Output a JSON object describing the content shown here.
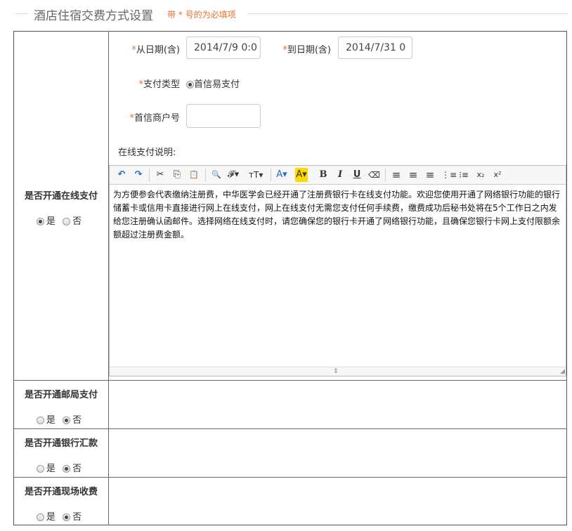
{
  "section": {
    "title": "酒店住宿交费方式设置",
    "hint": "带 * 号的为必填项"
  },
  "online": {
    "label": "是否开通在线支付",
    "yes": "是",
    "no": "否",
    "selected": "yes",
    "from_label": "从日期(含)",
    "from_value": "2014/7/9 0:0",
    "to_label": "到日期(含)",
    "to_value": "2014/7/31 0",
    "paytype_label": "支付类型",
    "paytype_option": "首信易支付",
    "merchant_label": "首信商户号",
    "merchant_value": "",
    "desc_label": "在线支付说明:",
    "desc_text": "为方便参会代表缴纳注册费，中华医学会已经开通了注册费银行卡在线支付功能。欢迎您使用开通了网络银行功能的银行储蓄卡或信用卡直接进行网上在线支付，网上在线支付无需您支付任何手续费，缴费成功后秘书处将在5个工作日之内发给您注册确认函邮件。选择网络在线支付时，请您确保您的银行卡开通了网络银行功能，且确保您银行卡网上支付限额余额超过注册费金额。"
  },
  "toolbar": {
    "undo": "↶",
    "redo": "↷",
    "cut": "✂",
    "copy": "⎘",
    "paste": "📋",
    "find": "🔍",
    "font": "𝓕▾",
    "size": "тT▾",
    "color": "A▾",
    "bg": "A▾",
    "bold": "B",
    "italic": "I",
    "underline": "U",
    "erase": "⌫",
    "al": "≡",
    "ac": "≡",
    "ar": "≡",
    "ol": "⋮≡",
    "ul": "⁝≡",
    "sub": "x₂",
    "sup": "x²"
  },
  "mail": {
    "label": "是否开通邮局支付",
    "yes": "是",
    "no": "否",
    "selected": "no"
  },
  "bank": {
    "label": "是否开通银行汇款",
    "yes": "是",
    "no": "否",
    "selected": "no"
  },
  "onsite": {
    "label": "是否开通现场收费",
    "yes": "是",
    "no": "否",
    "selected": "no"
  },
  "colors": {
    "required": "#e8702a",
    "border": "#555555"
  }
}
